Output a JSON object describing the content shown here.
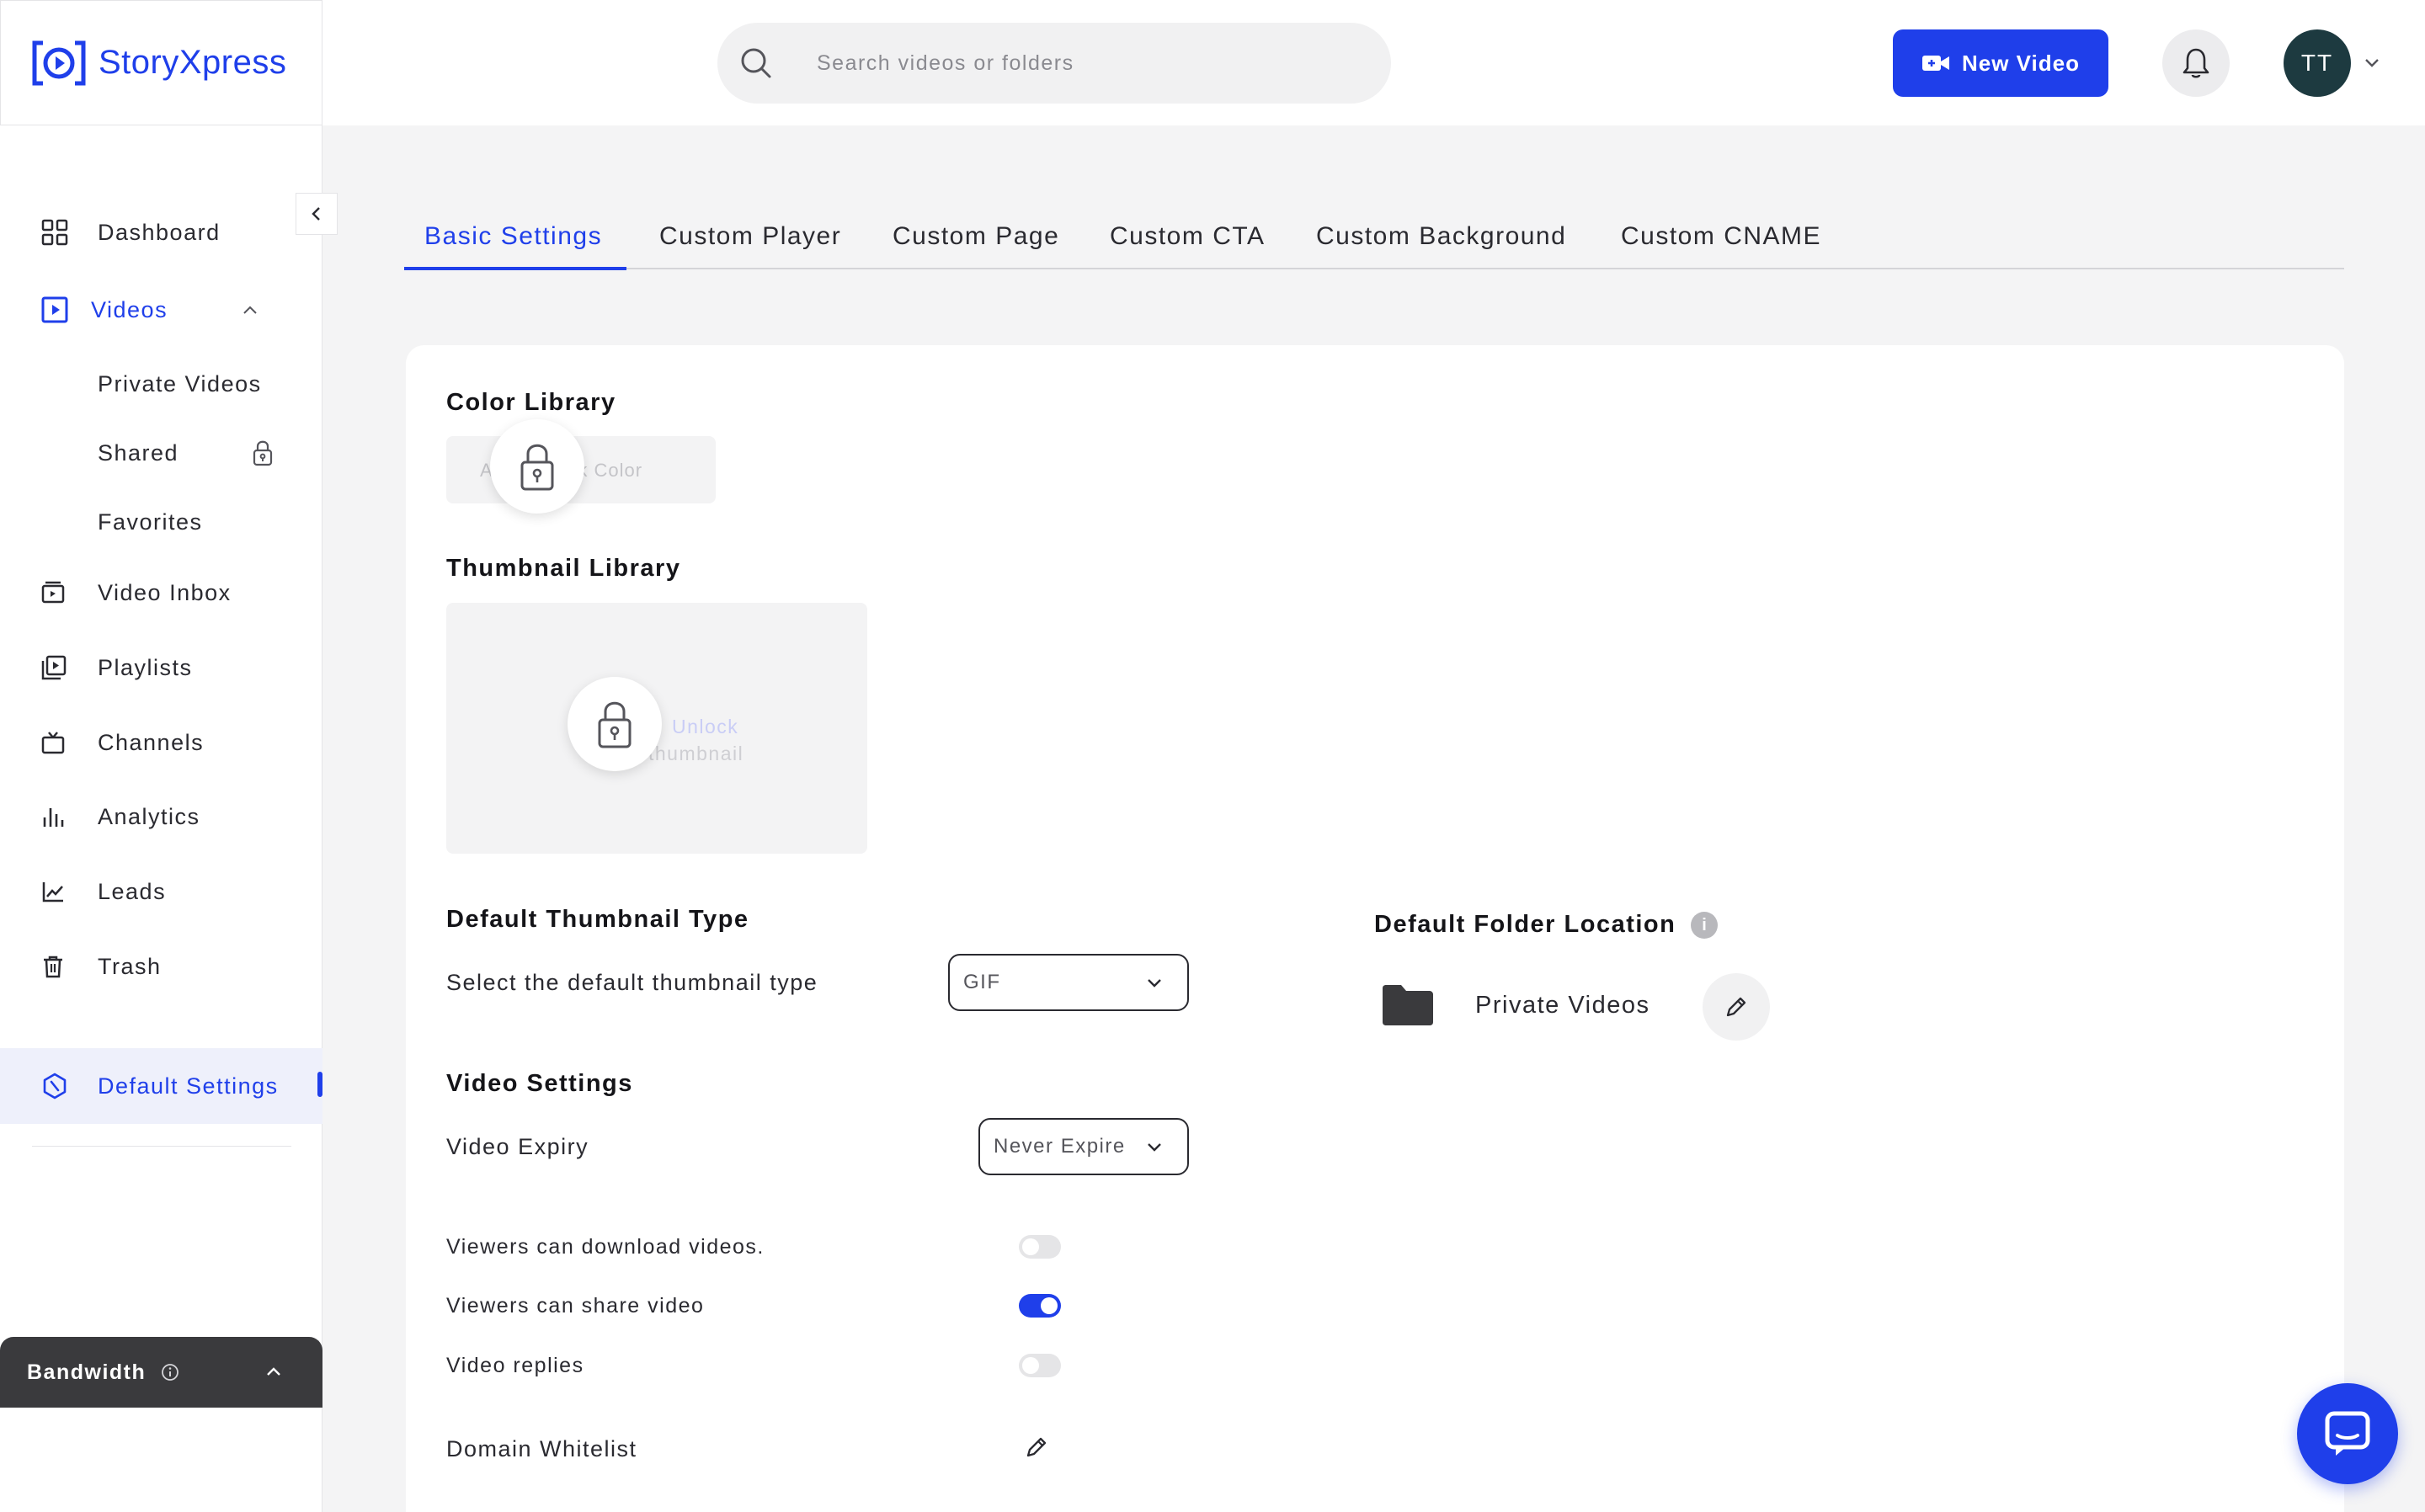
{
  "header": {
    "logo_text": "StoryXpress",
    "search_placeholder": "Search videos or folders",
    "new_video_label": "New Video",
    "avatar_initials": "TT"
  },
  "sidebar": {
    "items": [
      {
        "label": "Dashboard",
        "icon": "grid-icon"
      },
      {
        "label": "Videos",
        "icon": "play-square-icon",
        "active": true
      },
      {
        "label": "Private Videos"
      },
      {
        "label": "Shared",
        "icon": "lock-icon"
      },
      {
        "label": "Favorites"
      },
      {
        "label": "Video Inbox",
        "icon": "inbox-icon"
      },
      {
        "label": "Playlists",
        "icon": "playlist-icon"
      },
      {
        "label": "Channels",
        "icon": "tv-icon"
      },
      {
        "label": "Analytics",
        "icon": "bar-chart-icon"
      },
      {
        "label": "Leads",
        "icon": "line-chart-icon"
      },
      {
        "label": "Trash",
        "icon": "trash-icon"
      },
      {
        "label": "Default Settings",
        "icon": "settings-icon",
        "active": true
      }
    ],
    "bandwidth_label": "Bandwidth"
  },
  "tabs": [
    "Basic Settings",
    "Custom Player",
    "Custom Page",
    "Custom CTA",
    "Custom Background",
    "Custom CNAME"
  ],
  "settings": {
    "color_library_title": "Color Library",
    "color_library_ghost": "A        ou Unlock Color",
    "thumbnail_library_title": "Thumbnail Library",
    "thumbnail_ghost_1": "Unlock",
    "thumbnail_ghost_2": "thumbnail",
    "default_thumbnail_title": "Default Thumbnail Type",
    "default_thumbnail_label": "Select the default thumbnail type",
    "default_thumbnail_value": "GIF",
    "default_folder_title": "Default Folder Location",
    "default_folder_value": "Private Videos",
    "video_settings_title": "Video Settings",
    "video_expiry_label": "Video Expiry",
    "video_expiry_value": "Never Expire",
    "toggles": [
      {
        "label": "Viewers can download videos.",
        "on": false
      },
      {
        "label": "Viewers can share video",
        "on": true
      },
      {
        "label": "Video replies",
        "on": false
      }
    ],
    "domain_whitelist_label": "Domain Whitelist"
  },
  "colors": {
    "accent": "#1f3fea",
    "avatar_bg": "#1d3a40",
    "bandwidth_bg": "#3a3a3d"
  }
}
